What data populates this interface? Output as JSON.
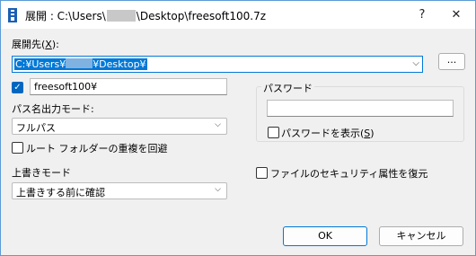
{
  "titlebar": {
    "title_prefix": "展開 : C:\\Users\\",
    "title_suffix": "\\Desktop\\freesoft100.7z",
    "help_glyph": "?",
    "close_glyph": "✕"
  },
  "extract_to": {
    "label": "展開先(",
    "hotkey": "X",
    "label_end": "):",
    "path_prefix": "C:¥Users¥",
    "path_suffix": "¥Desktop¥",
    "browse_label": "...",
    "chevron": "⌵"
  },
  "subfolder": {
    "checked": true,
    "check_glyph": "✓",
    "value": "freesoft100¥"
  },
  "path_mode": {
    "label": "パス名出力モード:",
    "value": "フルパス",
    "chevron": "⌵"
  },
  "remove_duplicate": {
    "label": "ルート フォルダーの重複を回避",
    "checked": false
  },
  "overwrite_mode": {
    "label": "上書きモード",
    "value": "上書きする前に確認",
    "chevron": "⌵"
  },
  "password": {
    "group_title": "パスワード",
    "value": "",
    "show_label": "パスワードを表示(",
    "show_hotkey": "S",
    "show_label_end": ")",
    "show_checked": false
  },
  "restore_security": {
    "label": "ファイルのセキュリティ属性を復元",
    "checked": false
  },
  "buttons": {
    "ok": "OK",
    "cancel": "キャンセル"
  },
  "colors": {
    "accent": "#0078d7",
    "check_fill": "#0067c0",
    "dialog_bg": "#f0f0f0"
  }
}
